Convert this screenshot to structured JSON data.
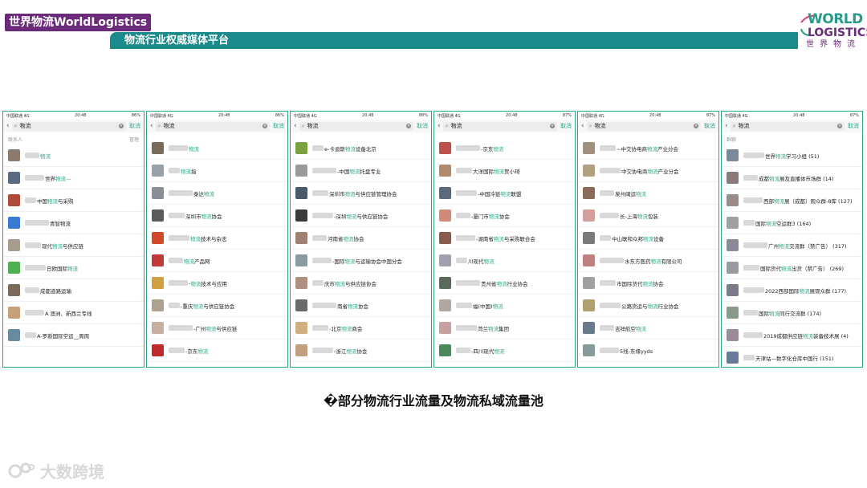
{
  "header": {
    "badge": "世界物流WorldLogistics",
    "subtitle": "物流行业权威媒体平台"
  },
  "logo": {
    "line1": "WORLD",
    "line2": "LOGISTICS",
    "line3": "世界物流"
  },
  "phones": [
    {
      "status": {
        "carrier": "中国联通 4G",
        "time": "20:48",
        "battery": "86%"
      },
      "search": {
        "query": "物流",
        "cancel": "取消"
      },
      "section": {
        "label": "联系人",
        "action": "管理"
      },
      "rows": [
        {
          "pre": "",
          "hl": "物流",
          "post": "",
          "thumb": "#8d7a6e"
        },
        {
          "pre": "世界",
          "hl": "物流",
          "post": "...",
          "thumb": "#5b6b7f"
        },
        {
          "pre": "中国",
          "hl": "物流",
          "post": "与采购",
          "thumb": "#b04a3a"
        },
        {
          "pre": "",
          "hl": "",
          "post": "青智物流",
          "thumb": "#3a7ad0"
        },
        {
          "pre": "现代",
          "hl": "物流",
          "post": "与供应链",
          "thumb": "#a89c8e"
        },
        {
          "pre": "日欧国际",
          "hl": "物流",
          "post": "",
          "thumb": "#4caf50"
        },
        {
          "pre": "成都道路运输",
          "hl": "",
          "post": "",
          "thumb": "#7a6a5a"
        },
        {
          "pre": "A 澳洲、新西兰专线",
          "hl": "",
          "post": "",
          "thumb": "#c6a07a"
        },
        {
          "pre": "A-罗新国际空运__周周",
          "hl": "",
          "post": "",
          "thumb": "#6a8aa0"
        }
      ]
    },
    {
      "status": {
        "carrier": "中国联通 4G",
        "time": "20:48",
        "battery": "86%"
      },
      "search": {
        "query": "物流",
        "cancel": "取消"
      },
      "rows": [
        {
          "pre": "",
          "hl": "物流",
          "post": "",
          "thumb": "#7a6a5a"
        },
        {
          "pre": "",
          "hl": "物流",
          "post": "指",
          "thumb": "#9aa0a8"
        },
        {
          "pre": "泰达",
          "hl": "物流",
          "post": "",
          "thumb": "#8a8f96"
        },
        {
          "pre": "深圳市",
          "hl": "物流",
          "post": "协会",
          "thumb": "#5a5a5a"
        },
        {
          "pre": "",
          "hl": "物流",
          "post": "技术与杂志",
          "thumb": "#d04a2a"
        },
        {
          "pre": "",
          "hl": "物流",
          "post": "产品网",
          "thumb": "#c03a3a"
        },
        {
          "pre": "-",
          "hl": "物流",
          "post": "技术与应用",
          "thumb": "#d0a040"
        },
        {
          "pre": "-重庆",
          "hl": "物流",
          "post": "与供应链协会",
          "thumb": "#b0a090"
        },
        {
          "pre": "-广州",
          "hl": "物流",
          "post": "与供应链",
          "thumb": "#c8b0a0"
        },
        {
          "pre": "-京东",
          "hl": "物流",
          "post": "",
          "thumb": "#c02a2a"
        }
      ]
    },
    {
      "status": {
        "carrier": "中国联通 4G",
        "time": "20:48",
        "battery": "88%"
      },
      "search": {
        "query": "物流",
        "cancel": "取消"
      },
      "rows": [
        {
          "pre": "e-卡迪斯",
          "hl": "物流",
          "post": "设备北京",
          "thumb": "#7aa040"
        },
        {
          "pre": "-中国",
          "hl": "物流",
          "post": "托盘专业",
          "thumb": "#9a9a9a"
        },
        {
          "pre": "深圳市",
          "hl": "物流",
          "post": "与供应链管理协会",
          "thumb": "#4a5a6a"
        },
        {
          "pre": "-深圳",
          "hl": "物流",
          "post": "与供应链协会",
          "thumb": "#3a3a3a"
        },
        {
          "pre": "河南省",
          "hl": "物流",
          "post": "协会",
          "thumb": "#a08070"
        },
        {
          "pre": "-国际",
          "hl": "物流",
          "post": "与运输协会中国分会",
          "thumb": "#8a9aa0"
        },
        {
          "pre": "庆市",
          "hl": "物流",
          "post": "与供应链协会",
          "thumb": "#b09080"
        },
        {
          "pre": "南省",
          "hl": "物流",
          "post": "协会",
          "thumb": "#6a6a6a"
        },
        {
          "pre": "-北京",
          "hl": "物流",
          "post": "商会",
          "thumb": "#d0b080"
        },
        {
          "pre": "-浙江",
          "hl": "物流",
          "post": "协会",
          "thumb": "#c0a080"
        }
      ]
    },
    {
      "status": {
        "carrier": "中国联通 4G",
        "time": "20:48",
        "battery": "87%"
      },
      "search": {
        "query": "物流",
        "cancel": "取消"
      },
      "rows": [
        {
          "pre": "-京东",
          "hl": "物流",
          "post": "",
          "thumb": "#c0504a"
        },
        {
          "pre": "大洋国际",
          "hl": "物流",
          "post": "贺小琦",
          "thumb": "#b08a6a"
        },
        {
          "pre": "-中国冷链",
          "hl": "物流",
          "post": "联盟",
          "thumb": "#5a6a7a"
        },
        {
          "pre": "-厦门市",
          "hl": "物流",
          "post": "协会",
          "thumb": "#d08a7a"
        },
        {
          "pre": "-湖南省",
          "hl": "物流",
          "post": "与采购联合会",
          "thumb": "#8a5a4a"
        },
        {
          "pre": "川现代",
          "hl": "物流",
          "post": "",
          "thumb": "#a0a0b0"
        },
        {
          "pre": "贵州省",
          "hl": "物流",
          "post": "行业协会",
          "thumb": "#5a6a5a"
        },
        {
          "pre": "福(中国)",
          "hl": "物流",
          "post": "",
          "thumb": "#b0a8a0"
        },
        {
          "pre": "菏兰",
          "hl": "物流",
          "post": "集团",
          "thumb": "#c8a0a0"
        },
        {
          "pre": "-四川现代",
          "hl": "物流",
          "post": "",
          "thumb": "#4a8a5a"
        }
      ]
    },
    {
      "status": {
        "carrier": "中国联通 4G",
        "time": "20:48",
        "battery": "87%"
      },
      "search": {
        "query": "物流",
        "cancel": "取消"
      },
      "rows": [
        {
          "pre": "~中交协电商",
          "hl": "物流",
          "post": "产业分会",
          "thumb": "#a09080"
        },
        {
          "pre": "中交协电商",
          "hl": "物流",
          "post": "产业分会",
          "thumb": "#b0a080"
        },
        {
          "pre": "泉州闽运",
          "hl": "物流",
          "post": "",
          "thumb": "#8a6a5a"
        },
        {
          "pre": "长-上海",
          "hl": "物流",
          "post": "包装",
          "thumb": "#d0a0a0"
        },
        {
          "pre": "中山联和众邦",
          "hl": "物流",
          "post": "设备",
          "thumb": "#7a7a7a"
        },
        {
          "pre": "水东方医药",
          "hl": "物流",
          "post": "有限公司",
          "thumb": "#c08080"
        },
        {
          "pre": "市国际货代",
          "hl": "物流",
          "post": "协会",
          "thumb": "#a0a0a0"
        },
        {
          "pre": "公路货运与",
          "hl": "物流",
          "post": "行业协会",
          "thumb": "#b0a070"
        },
        {
          "pre": "吉祥航空",
          "hl": "物流",
          "post": "",
          "thumb": "#6a7a8a"
        },
        {
          "pre": "5线-东缘yyds",
          "hl": "",
          "post": "",
          "thumb": "#8a9a9a"
        }
      ]
    },
    {
      "status": {
        "carrier": "中国联通 4G",
        "time": "20:48",
        "battery": "87%"
      },
      "search": {
        "query": "物流",
        "cancel": "取消"
      },
      "section": {
        "label": "群聊",
        "action": ""
      },
      "rows": [
        {
          "pre": "世界",
          "hl": "物流",
          "post": "学习小组 (51)",
          "thumb": "#7a8a9a"
        },
        {
          "pre": "成都",
          "hl": "物流",
          "post": "展及直播体市场群 (14)",
          "thumb": "#8a7a7a"
        },
        {
          "pre": "西部",
          "hl": "物流",
          "post": "展（成都）观众群-8库 (127)",
          "thumb": "#9a8a8a"
        },
        {
          "pre": "国际",
          "hl": "物流",
          "post": "空运群3 (164)",
          "thumb": "#a0a0a0"
        },
        {
          "pre": "广州",
          "hl": "物流",
          "post": "交流群（禁广告） (317)",
          "thumb": "#8a8a9a"
        },
        {
          "pre": "国际货代",
          "hl": "物流",
          "post": "出货（禁广告） (269)",
          "thumb": "#9a9aa0"
        },
        {
          "pre": "2022西部国际",
          "hl": "物流",
          "post": "展观众群 (177)",
          "thumb": "#7a7a8a"
        },
        {
          "pre": "国际",
          "hl": "物流",
          "post": "同行交流群 (174)",
          "thumb": "#8a9a8a"
        },
        {
          "pre": "2019成都供应链",
          "hl": "物流",
          "post": "装备技术展 (4)",
          "thumb": "#9a8a9a"
        },
        {
          "pre": "天津站—数字化仓库中国行 (151)",
          "hl": "",
          "post": "",
          "thumb": "#6a7a9a"
        }
      ]
    }
  ],
  "caption": "�部分物流行业流量及物流私域流量池",
  "watermark": "大数跨境"
}
